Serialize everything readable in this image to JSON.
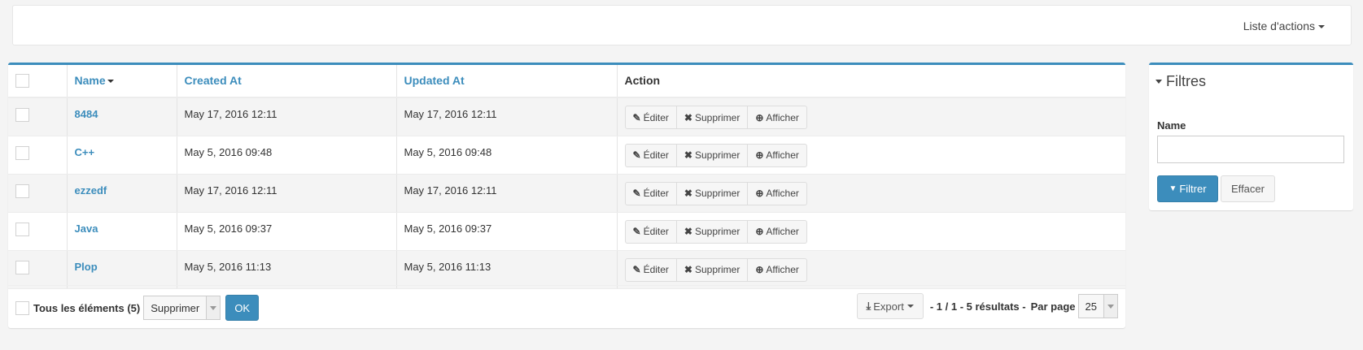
{
  "header": {
    "actions_menu_label": "Liste d'actions"
  },
  "table": {
    "columns": {
      "name": "Name",
      "created_at": "Created At",
      "updated_at": "Updated At",
      "action": "Action"
    },
    "rows": [
      {
        "name": "8484",
        "created_at": "May 17, 2016 12:11",
        "updated_at": "May 17, 2016 12:11"
      },
      {
        "name": "C++",
        "created_at": "May 5, 2016 09:48",
        "updated_at": "May 5, 2016 09:48"
      },
      {
        "name": "ezzedf",
        "created_at": "May 17, 2016 12:11",
        "updated_at": "May 17, 2016 12:11"
      },
      {
        "name": "Java",
        "created_at": "May 5, 2016 09:37",
        "updated_at": "May 5, 2016 09:37"
      },
      {
        "name": "Plop",
        "created_at": "May 5, 2016 11:13",
        "updated_at": "May 5, 2016 11:13"
      }
    ],
    "row_actions": {
      "edit": "Éditer",
      "delete": "Supprimer",
      "show": "Afficher"
    }
  },
  "footer": {
    "select_all_label": "Tous les éléments (5)",
    "batch_action_selected": "Supprimer",
    "ok_label": "OK",
    "export_label": "Export",
    "pager": "- 1 / 1 - 5 résultats -",
    "per_page_label": "Par page",
    "per_page_value": "25"
  },
  "filters": {
    "title": "Filtres",
    "name_label": "Name",
    "filter_button": "Filtrer",
    "clear_button": "Effacer"
  },
  "colors": {
    "accent": "#3c8dbc"
  }
}
